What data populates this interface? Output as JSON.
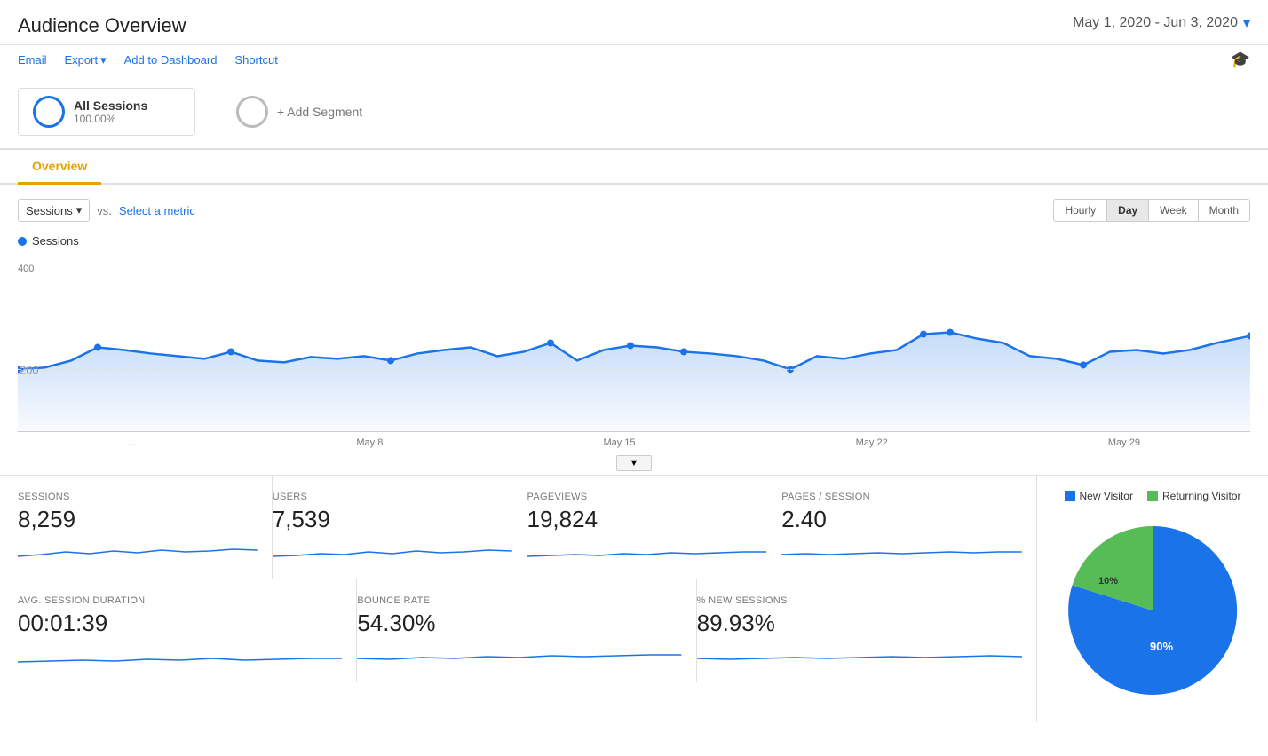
{
  "header": {
    "title": "Audience Overview",
    "date_range": "May 1, 2020 - Jun 3, 2020"
  },
  "toolbar": {
    "email": "Email",
    "export": "Export",
    "add_to_dashboard": "Add to Dashboard",
    "shortcut": "Shortcut"
  },
  "segments": {
    "all_sessions_label": "All Sessions",
    "all_sessions_pct": "100.00%",
    "add_segment_label": "+ Add Segment"
  },
  "tabs": [
    "Overview"
  ],
  "chart": {
    "metric_label": "Sessions",
    "vs_label": "vs.",
    "select_metric": "Select a metric",
    "y_value": "400",
    "y_value2": "200",
    "time_buttons": [
      "Hourly",
      "Day",
      "Week",
      "Month"
    ],
    "active_time_btn": "Day",
    "x_labels": [
      "...",
      "May 8",
      "May 15",
      "May 22",
      "May 29"
    ],
    "legend_label": "Sessions"
  },
  "metrics_row1": [
    {
      "label": "Sessions",
      "value": "8,259"
    },
    {
      "label": "Users",
      "value": "7,539"
    },
    {
      "label": "Pageviews",
      "value": "19,824"
    },
    {
      "label": "Pages / Session",
      "value": "2.40"
    }
  ],
  "metrics_row2": [
    {
      "label": "Avg. Session Duration",
      "value": "00:01:39"
    },
    {
      "label": "Bounce Rate",
      "value": "54.30%"
    },
    {
      "label": "% New Sessions",
      "value": "89.93%"
    }
  ],
  "pie_chart": {
    "new_visitor_label": "New Visitor",
    "returning_visitor_label": "Returning Visitor",
    "new_visitor_pct": 90,
    "returning_visitor_pct": 10,
    "new_visitor_pct_label": "90%",
    "returning_visitor_pct_label": "10%",
    "new_color": "#1a73e8",
    "returning_color": "#57bb56"
  }
}
